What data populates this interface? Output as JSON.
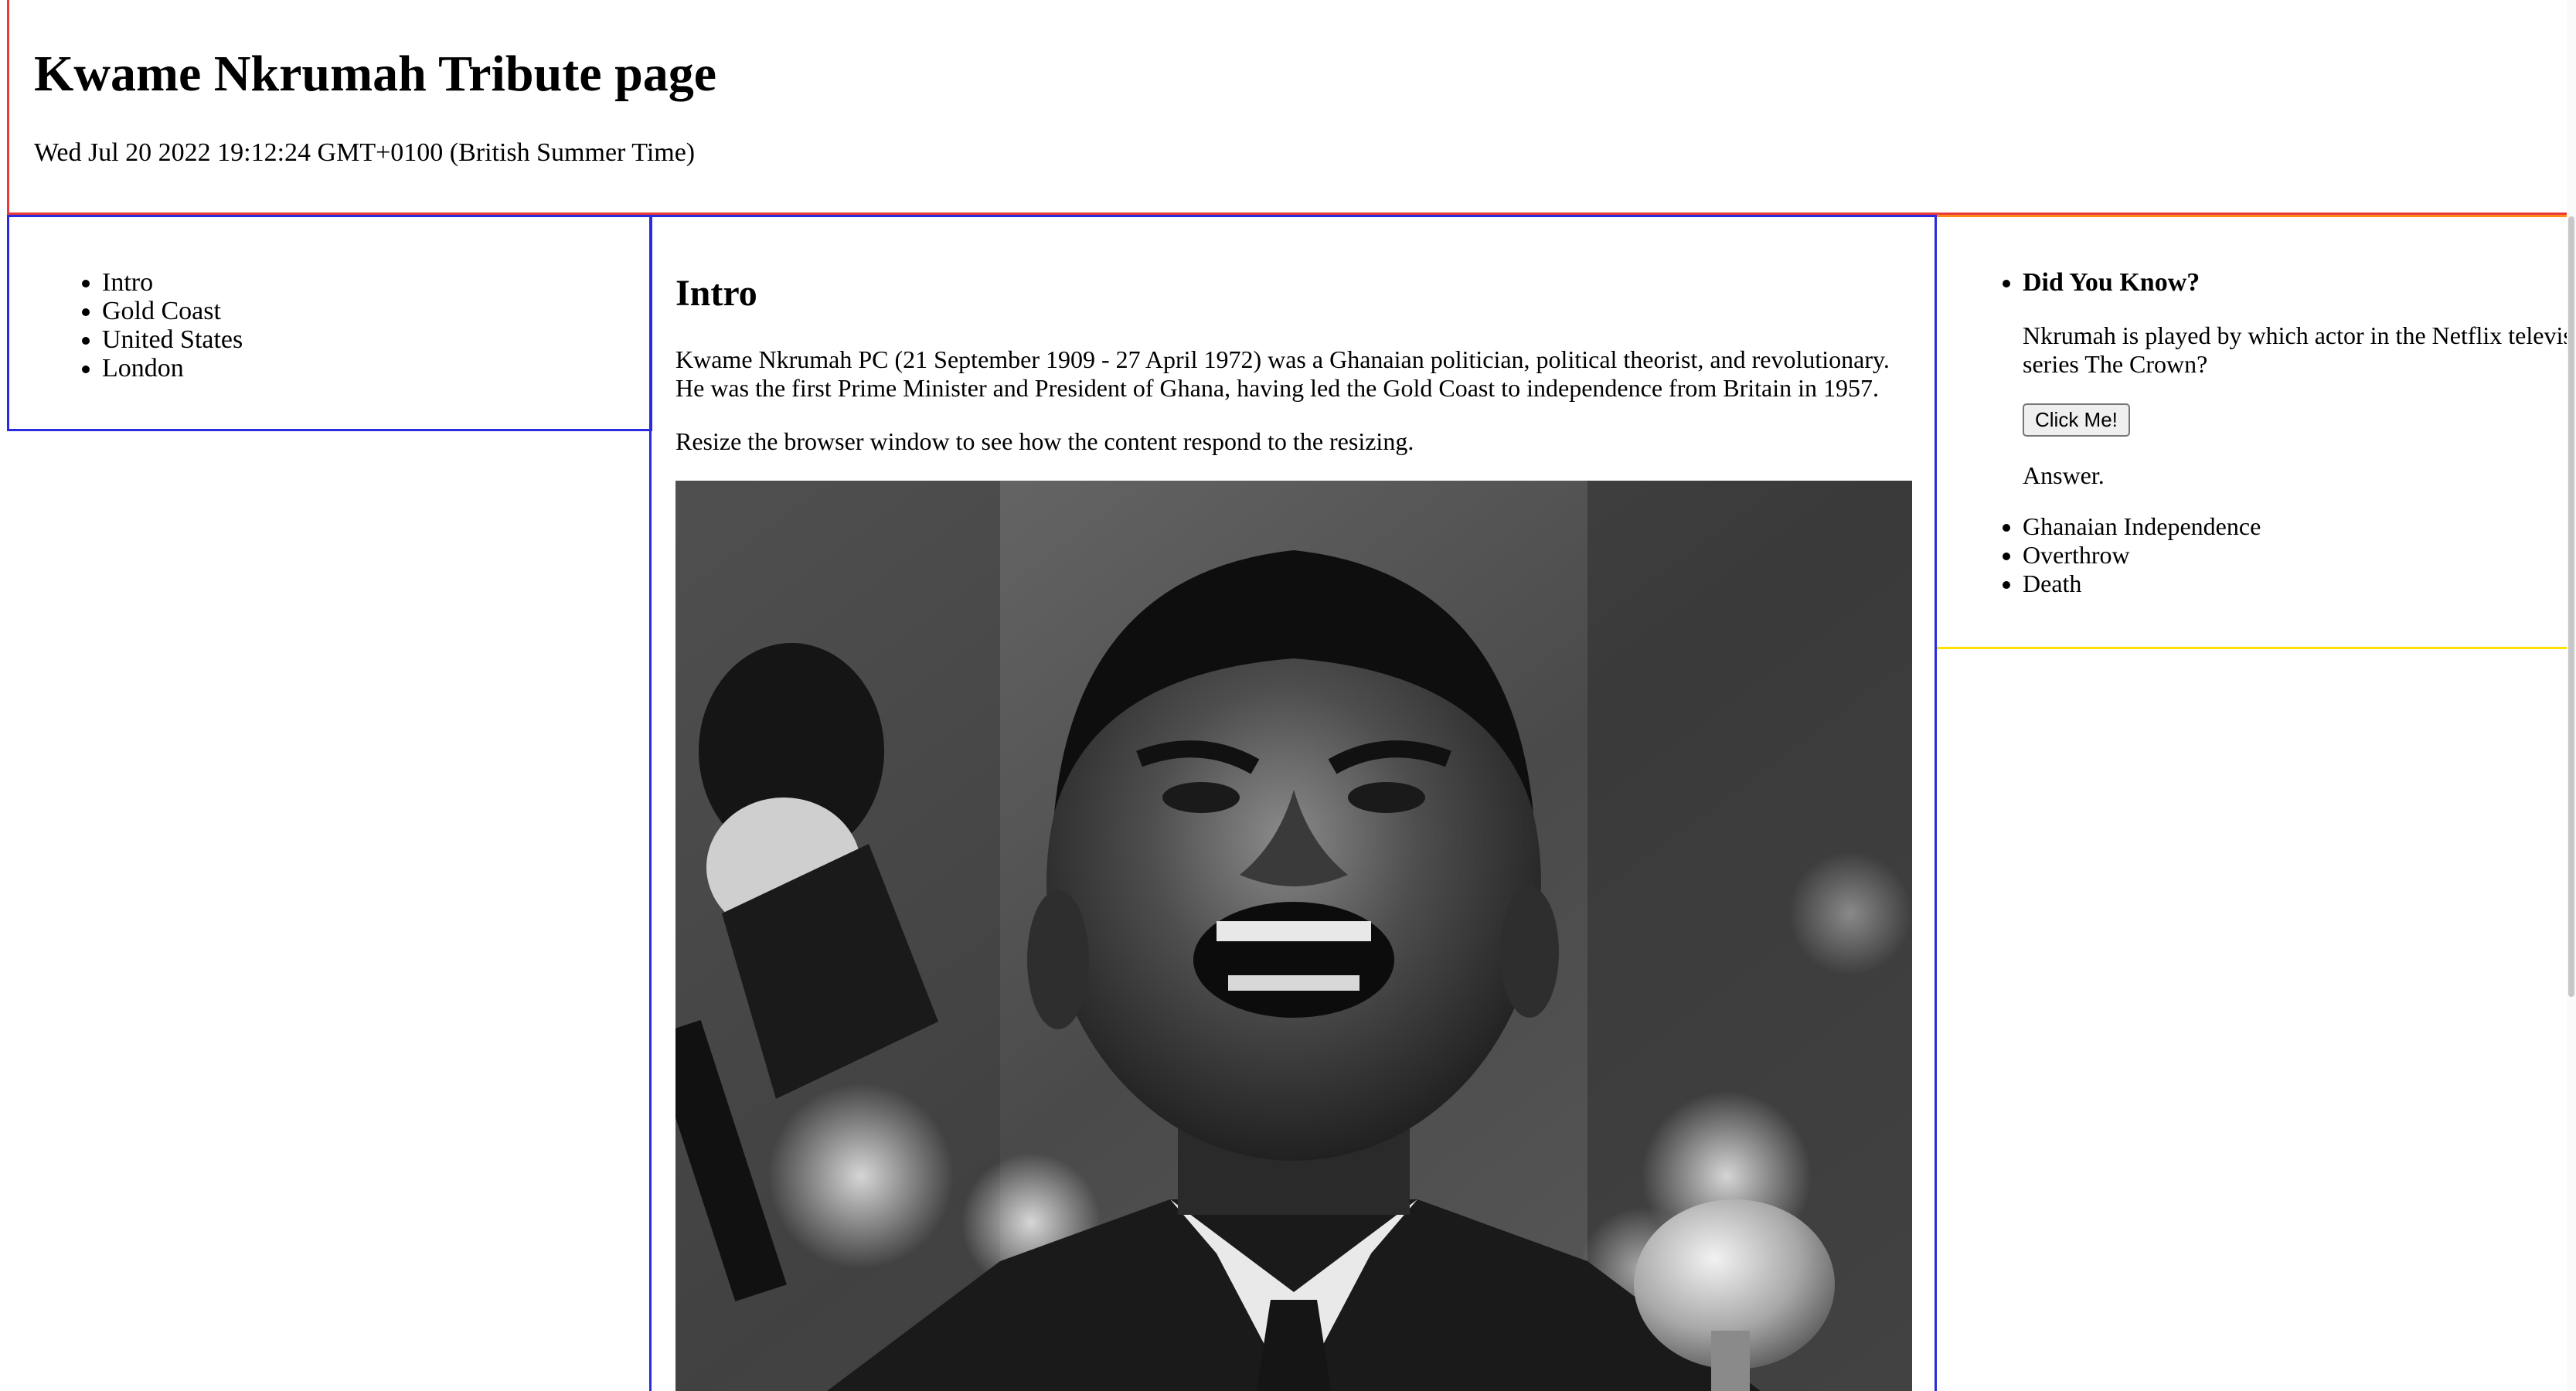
{
  "header": {
    "title": "Kwame Nkrumah Tribute page",
    "date": "Wed Jul 20 2022 19:12:24 GMT+0100 (British Summer Time)"
  },
  "nav": {
    "items": [
      "Intro",
      "Gold Coast",
      "United States",
      "London"
    ]
  },
  "main": {
    "heading": "Intro",
    "bio": "Kwame Nkrumah PC (21 September 1909 - 27 April 1972) was a Ghanaian politician, political theorist, and revolutionary. He was the first Prime Minister and President of Ghana, having led the Gold Coast to independence from Britain in 1957.",
    "resize_note": "Resize the browser window to see how the content respond to the resizing.",
    "image": {
      "subject": "black-and-white portrait of Kwame Nkrumah speaking at microphones"
    }
  },
  "sidebar": {
    "did_you_know_title": "Did You Know?",
    "question": "Nkrumah is played by which actor in the Netflix television series The Crown?",
    "button_label": "Click Me!",
    "answer_label": "Answer.",
    "events": [
      "Ghanaian Independence",
      "Overthrow",
      "Death"
    ]
  },
  "colors": {
    "header_border": "#e83a3a",
    "nav_border": "#2a2ae0",
    "main_border": "#2a2ae0",
    "sidebar_top_border": "#ff8c1a",
    "sidebar_bottom_border": "#ffe000"
  }
}
